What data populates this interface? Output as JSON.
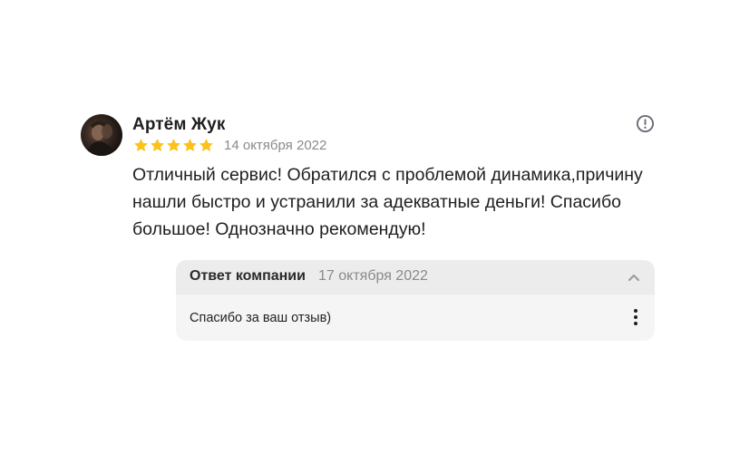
{
  "review": {
    "author": "Артём Жук",
    "rating": 5,
    "rating_max": 5,
    "date": "14 октября 2022",
    "text": "Отличный сервис! Обратился с проблемой динамика,причину нашли быстро и устранили за адекватные деньги! Спасибо большое! Однозначно рекомендую!"
  },
  "reply": {
    "label": "Ответ компании",
    "date": "17 октября 2022",
    "text": "Спасибо за ваш отзыв)"
  },
  "colors": {
    "star": "#fcc21b",
    "secondary_text": "#8a8a8a",
    "reply_header_bg": "#ececec",
    "reply_body_bg": "#f5f5f5"
  },
  "icons": {
    "report": "exclamation-circle-icon",
    "collapse": "chevron-up-icon",
    "more": "vertical-dots-icon"
  }
}
